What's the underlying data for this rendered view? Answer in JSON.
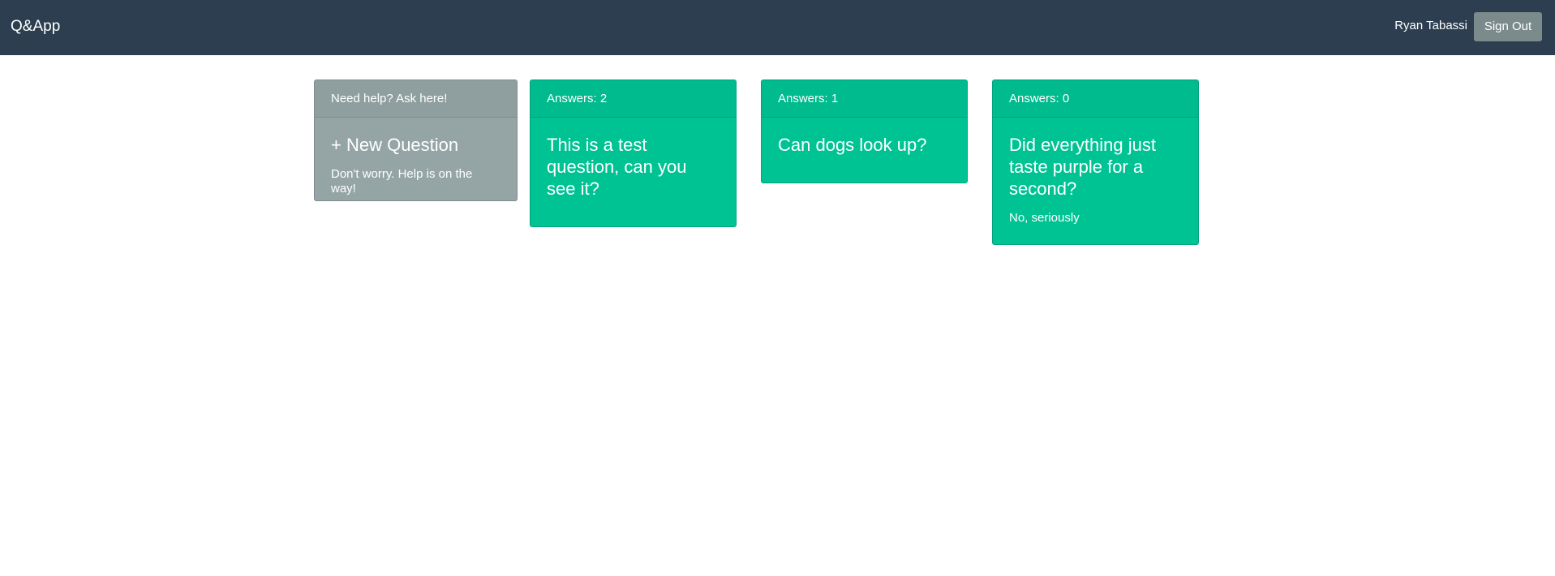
{
  "navbar": {
    "brand": "Q&App",
    "user_name": "Ryan Tabassi",
    "sign_out_label": "Sign Out"
  },
  "new_question_card": {
    "header": "Need help? Ask here!",
    "title": "+ New Question",
    "text": "Don't worry. Help is on the way!"
  },
  "questions": [
    {
      "header": "Answers: 2",
      "title": "This is a test question, can you see it?",
      "text": ""
    },
    {
      "header": "Answers: 1",
      "title": "Can dogs look up?",
      "text": ""
    },
    {
      "header": "Answers: 0",
      "title": "Did everything just taste purple for a second?",
      "text": "No, seriously"
    }
  ],
  "colors": {
    "navbar": "#2c3e50",
    "card_gray": "#95a5a6",
    "card_green": "#00c394",
    "button_gray": "#7b8a8b"
  }
}
